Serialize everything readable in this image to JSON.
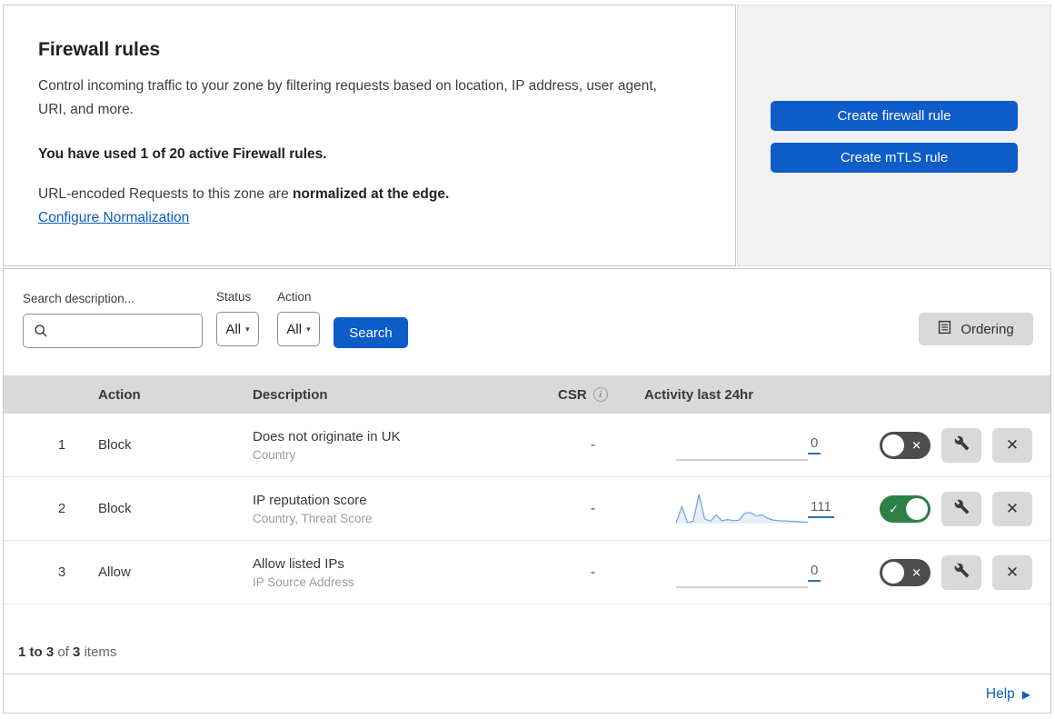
{
  "colors": {
    "accent_blue": "#0d5cc7",
    "link_blue": "#0b5cc4",
    "toggle_on_green": "#2d8046",
    "toggle_off_gray": "#4d4d4d",
    "gray_button": "#d9d9d9",
    "table_header_bg": "#d9d9d9",
    "spark_line": "#7aa5e0",
    "spark_fill": "rgba(122,165,224,0.18)",
    "spark_flat": "#b9bdc2"
  },
  "icons": {
    "info_glyph": "i",
    "dropdown_glyph": "▾",
    "toggle_on_glyph": "✓",
    "toggle_off_glyph": "✕",
    "delete_glyph": "✕",
    "help_arrow_glyph": "▶"
  },
  "intro": {
    "title": "Firewall rules",
    "description": "Control incoming traffic to your zone by filtering requests based on location, IP address, user agent, URI, and more.",
    "usage": "You have used 1 of 20 active Firewall rules.",
    "normalization_prefix": "URL-encoded Requests to this zone are ",
    "normalization_bold": "normalized at the edge.",
    "configure_link": "Configure Normalization"
  },
  "side_panel": {
    "create_firewall_label": "Create firewall rule",
    "create_mtls_label": "Create mTLS rule"
  },
  "filters": {
    "search_label": "Search description...",
    "search_value": "",
    "status": {
      "label": "Status",
      "value": "All"
    },
    "action": {
      "label": "Action",
      "value": "All"
    },
    "search_button": "Search",
    "ordering_button": "Ordering"
  },
  "table": {
    "headers": {
      "action": "Action",
      "description": "Description",
      "csr": "CSR",
      "activity": "Activity last 24hr"
    },
    "rows": [
      {
        "num": "1",
        "action": "Block",
        "description": "Does not originate in UK",
        "criteria": "Country",
        "csr": "-",
        "activity_count": "0",
        "sparkline": [
          0,
          0
        ],
        "toggle_state": "off"
      },
      {
        "num": "2",
        "action": "Block",
        "description": "IP reputation score",
        "criteria": "Country, Threat Score",
        "csr": "-",
        "activity_count": "111",
        "sparkline": [
          2,
          58,
          4,
          8,
          100,
          16,
          8,
          30,
          10,
          14,
          10,
          12,
          36,
          38,
          26,
          30,
          18,
          12,
          10,
          9,
          8,
          7,
          6,
          5
        ],
        "toggle_state": "on"
      },
      {
        "num": "3",
        "action": "Allow",
        "description": "Allow listed IPs",
        "criteria": "IP Source Address",
        "csr": "-",
        "activity_count": "0",
        "sparkline": [
          0,
          0
        ],
        "toggle_state": "off"
      }
    ]
  },
  "footer": {
    "range": "1 to 3",
    "of": "of",
    "total": "3",
    "items": "items"
  },
  "help": {
    "label": "Help"
  }
}
